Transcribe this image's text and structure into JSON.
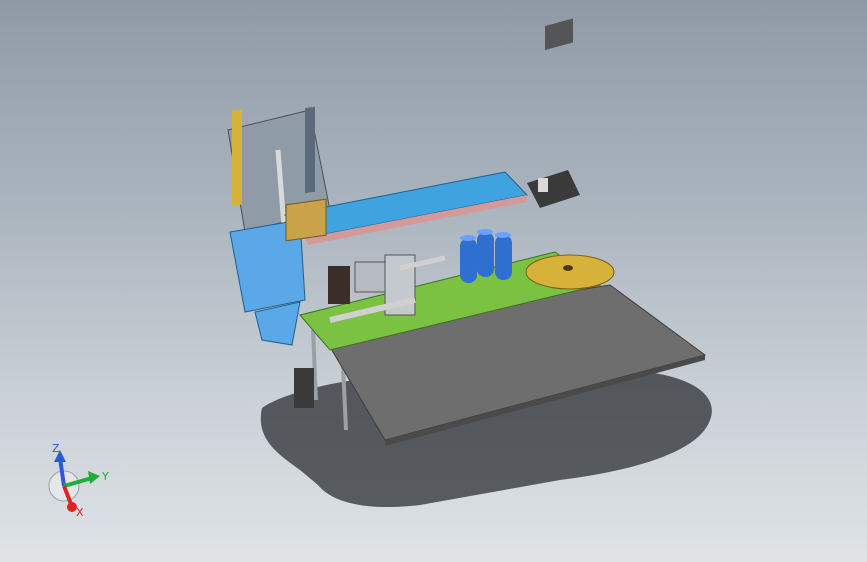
{
  "viewport": {
    "background_top": "#8f9aa6",
    "background_bottom": "#dfe3e6"
  },
  "triad": {
    "z_label": "Z",
    "y_label": "Y",
    "x_label": "X",
    "z_color": "#2a5bd7",
    "y_color": "#1fae3b",
    "x_color": "#e02424"
  },
  "model": {
    "colors": {
      "base_plate": "#6e6e6e",
      "pcb": "#7bc142",
      "slide_rail": "#3fa3e0",
      "gold_disk": "#d6b23a",
      "capacitor": "#2f6fd0",
      "motor": "#3a3a3a",
      "chip": "#c9a24a"
    }
  }
}
